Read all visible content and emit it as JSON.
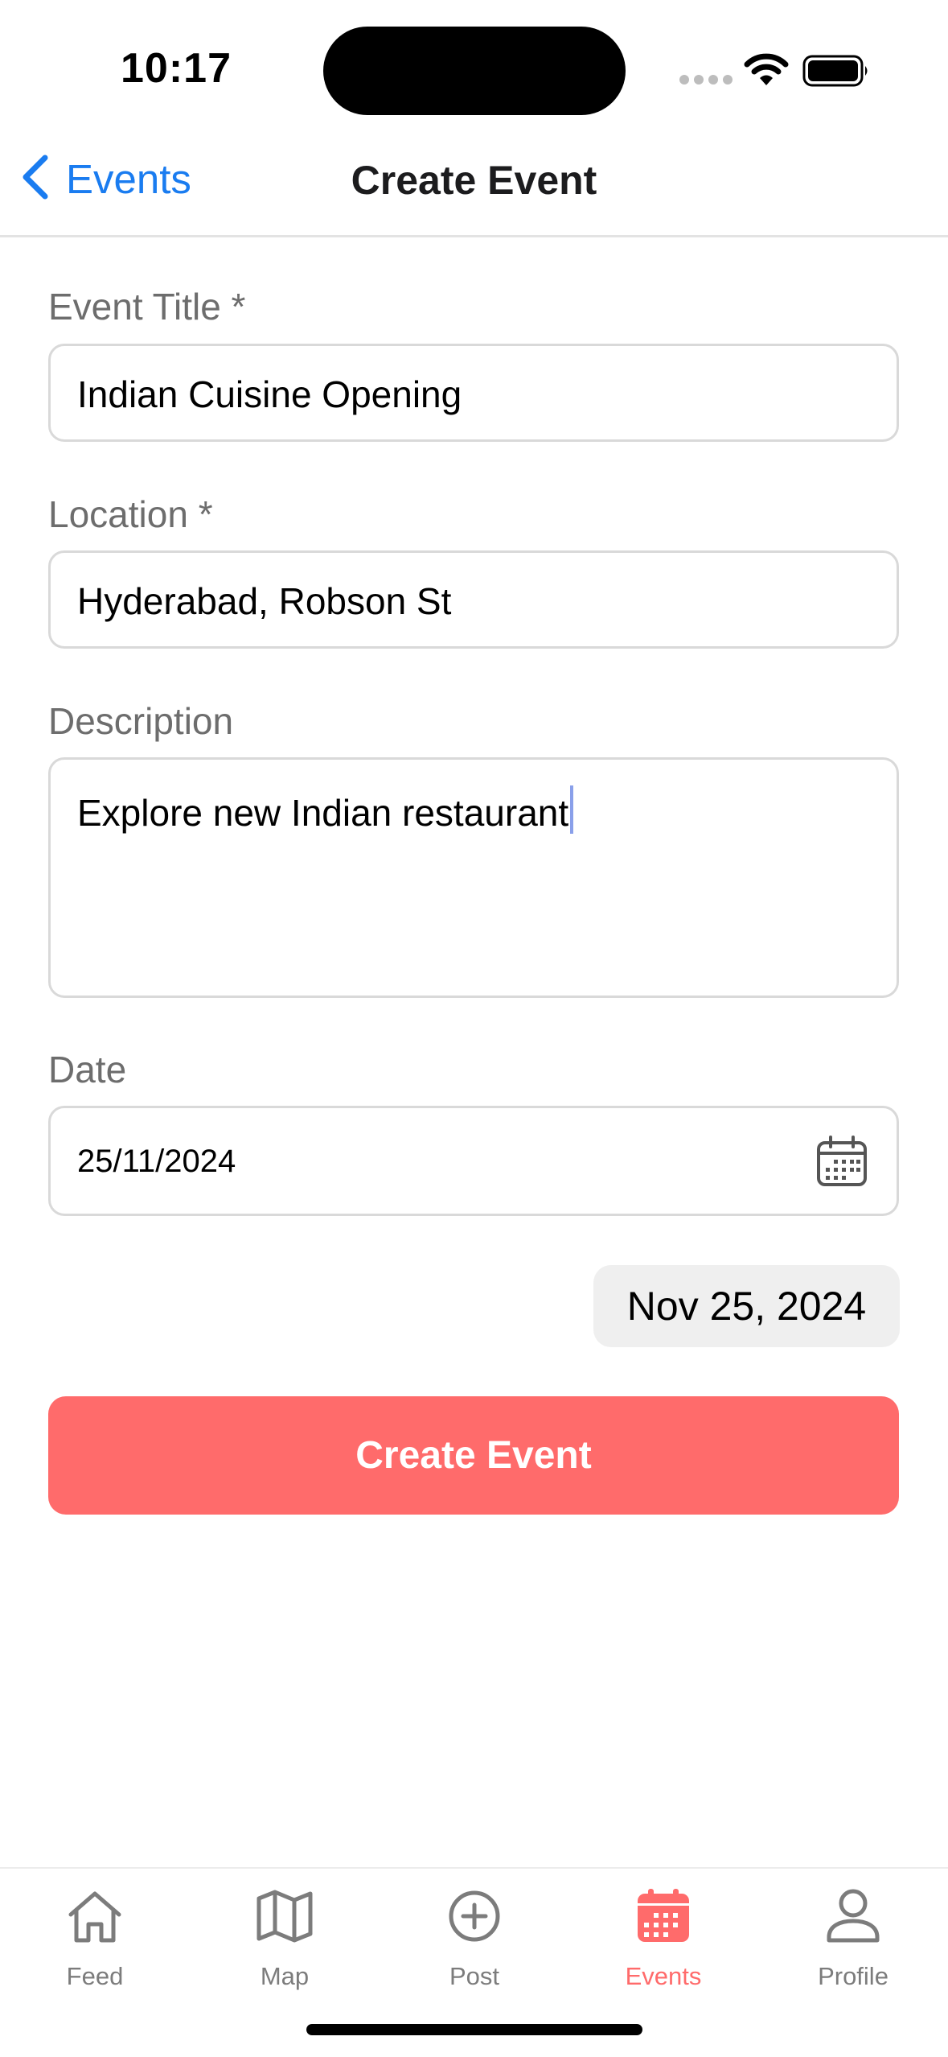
{
  "status_bar": {
    "time": "10:17"
  },
  "nav": {
    "back_label": "Events",
    "title": "Create Event"
  },
  "form": {
    "title_label": "Event Title *",
    "title_value": "Indian Cuisine Opening",
    "location_label": "Location *",
    "location_value": "Hyderabad, Robson St",
    "description_label": "Description",
    "description_value": "Explore new Indian restaurant",
    "date_label": "Date",
    "date_value": "25/11/2024",
    "date_display": "Nov 25, 2024",
    "submit_label": "Create Event"
  },
  "tabs": [
    {
      "label": "Feed",
      "icon": "home-icon",
      "active": false
    },
    {
      "label": "Map",
      "icon": "map-icon",
      "active": false
    },
    {
      "label": "Post",
      "icon": "plus-circle-icon",
      "active": false
    },
    {
      "label": "Events",
      "icon": "calendar-icon",
      "active": true
    },
    {
      "label": "Profile",
      "icon": "person-icon",
      "active": false
    }
  ],
  "colors": {
    "accent": "#ff6b6b",
    "link": "#1a7cf0",
    "inactive_tab": "#7c7c7c"
  }
}
